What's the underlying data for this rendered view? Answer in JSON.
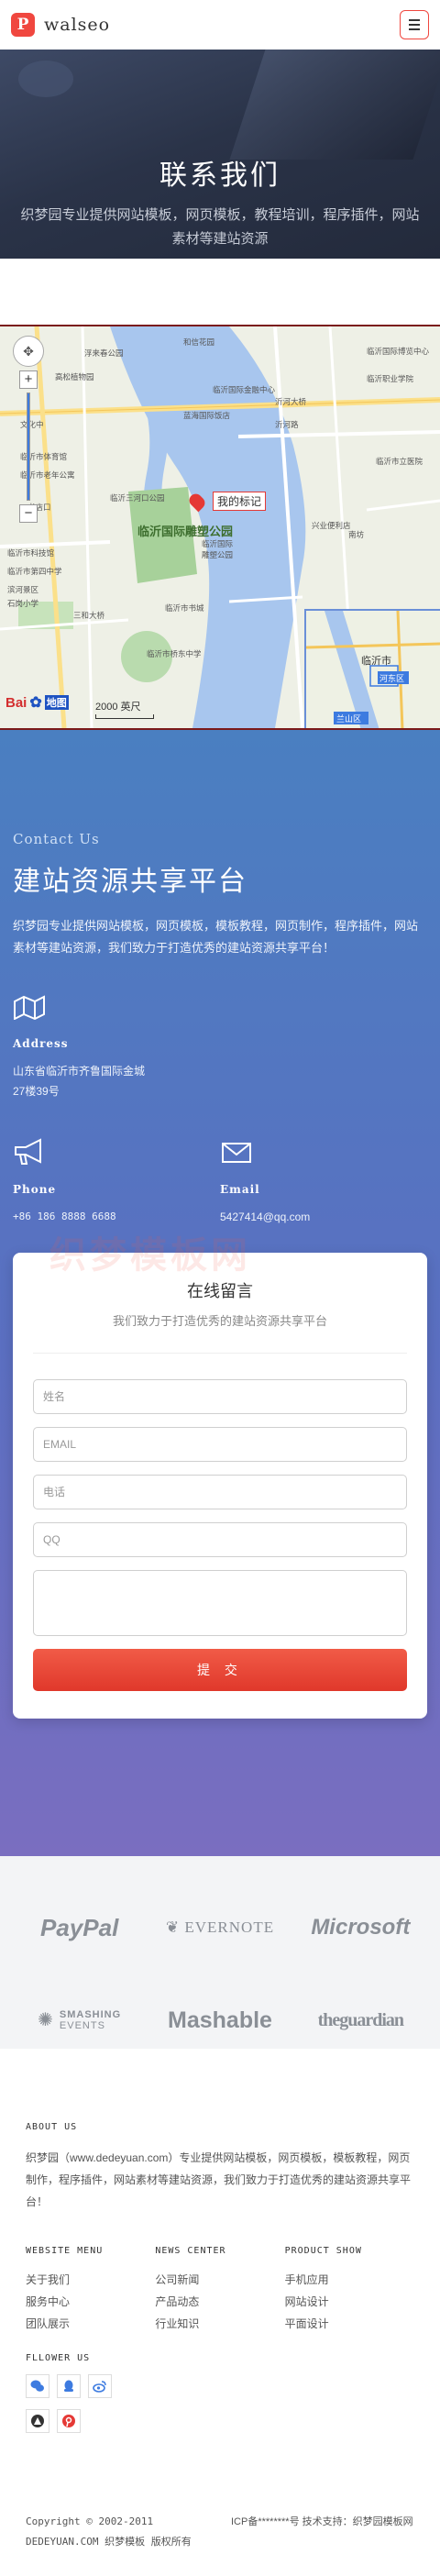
{
  "header": {
    "brand": "walseo",
    "logo_letter": "P"
  },
  "hero": {
    "title": "联系我们",
    "subtitle": "织梦园专业提供网站模板，网页模板，教程培训，程序插件，网站素材等建站资源"
  },
  "map": {
    "zoom_in": "+",
    "zoom_out": "−",
    "marker_label": "我的标记",
    "logo": "Bai",
    "logo_suffix": "地图",
    "scale": "2000 英尺",
    "overview_city": "临沂市",
    "overview_district": "兰山区",
    "overview_mark": "河东区",
    "labels": {
      "l1": "浮来春公园",
      "l2": "高松植物园",
      "l3": "文化中",
      "l4": "临沂市体育馆",
      "l5": "临沂市老年公寓",
      "l6": "临沂市科技馆",
      "l7": "临沂国际金融中心",
      "l8": "临沂市立医院",
      "l9": "书店口",
      "l10": "临沂市第四中学",
      "l11": "蓝海国际饭店",
      "l12": "沂河大桥",
      "l13": "临沂三河口公园",
      "l14": "临沂国际",
      "l15": "雕塑公园",
      "l16": "临沂国际雕塑公园",
      "l17": "兴业便利店",
      "l18": "临沂市书城",
      "l19": "临沂市桥东中学",
      "l20": "三和大桥",
      "l21": "滨河景区",
      "l22": "石岗小学",
      "l23": "和信花园",
      "l24": "沂河路",
      "l25": "临沂国际博览中心",
      "l26": "临沂职业学院",
      "l27": "南坊"
    }
  },
  "contact": {
    "eyebrow": "Contact Us",
    "title": "建站资源共享平台",
    "desc": "织梦园专业提供网站模板，网页模板，模板教程，网页制作，程序插件，网站素材等建站资源，我们致力于打造优秀的建站资源共享平台！",
    "address_label": "Address",
    "address_value": "山东省临沂市齐鲁国际金城27楼39号",
    "phone_label": "Phone",
    "phone_value": "+86 186 8888 6688",
    "email_label": "Email",
    "email_value": "5427414@qq.com"
  },
  "form": {
    "watermark": "织梦模板网",
    "title": "在线留言",
    "subtitle": "我们致力于打造优秀的建站资源共享平台",
    "name_placeholder": "姓名",
    "email_placeholder": "EMAIL",
    "phone_placeholder": "电话",
    "qq_placeholder": "QQ",
    "submit": "提 交"
  },
  "partners": {
    "p1": "PayPal",
    "p2": "EVERNOTE",
    "p3": "Microsoft",
    "p4": "SMASHING",
    "p4_sub": "EVENTS",
    "p5": "Mashable",
    "p6": "theguardian"
  },
  "footer": {
    "about_heading": "ABOUT US",
    "about_text": "织梦园（www.dedeyuan.com）专业提供网站模板，网页模板，模板教程，网页制作，程序插件，网站素材等建站资源，我们致力于打造优秀的建站资源共享平台！",
    "col1_heading": "WEBSITE MENU",
    "col1_items": [
      "关于我们",
      "服务中心",
      "团队展示"
    ],
    "col2_heading": "NEWS CENTER",
    "col2_items": [
      "公司新闻",
      "产品动态",
      "行业知识"
    ],
    "col3_heading": "PRODUCT SHOW",
    "col3_items": [
      "手机应用",
      "网站设计",
      "平面设计"
    ],
    "follow_heading": "FLLOWER US",
    "copyright": "Copyright © 2002-2011 DEDEYUAN.COM 织梦模板 版权所有",
    "icp": "ICP备********号 技术支持：织梦园模板网"
  },
  "colors": {
    "accent": "#f0473f",
    "contact_top": "#4a7fc1",
    "contact_bottom": "#7a6ec0"
  },
  "icons": {
    "brand": "p-logo-icon",
    "menu": "hamburger-icon",
    "address": "map-icon",
    "phone": "megaphone-icon",
    "email": "envelope-icon",
    "wechat": "wechat-icon",
    "qq": "qq-icon",
    "weibo": "weibo-icon",
    "douban": "douban-icon",
    "pinterest": "pinterest-icon"
  }
}
